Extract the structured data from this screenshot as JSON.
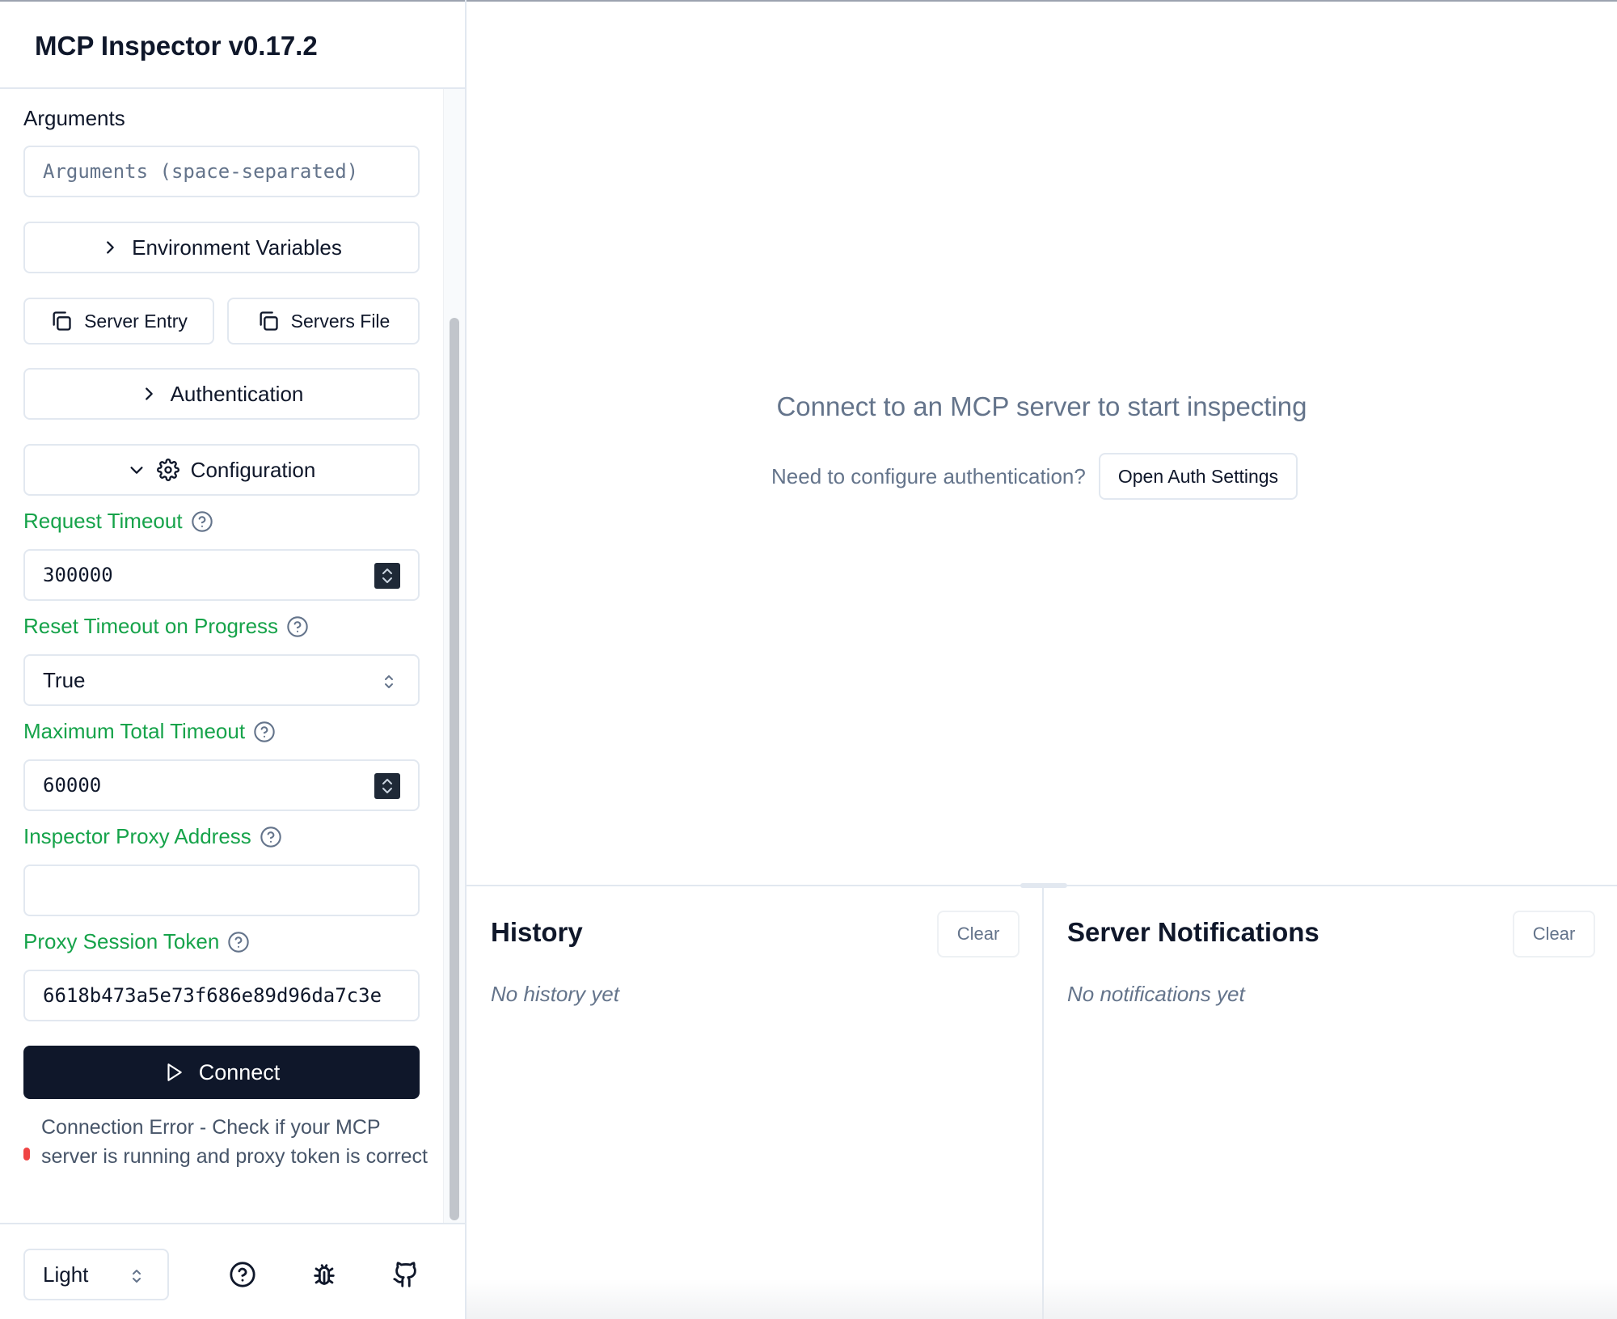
{
  "app": {
    "title": "MCP Inspector v0.17.2"
  },
  "sidebar": {
    "arguments_label": "Arguments",
    "arguments_placeholder": "Arguments (space-separated)",
    "env_vars_label": "Environment Variables",
    "server_entry_label": "Server Entry",
    "servers_file_label": "Servers File",
    "authentication_label": "Authentication",
    "configuration_label": "Configuration",
    "request_timeout": {
      "label": "Request Timeout",
      "value": "300000"
    },
    "reset_timeout": {
      "label": "Reset Timeout on Progress",
      "value": "True"
    },
    "max_total_timeout": {
      "label": "Maximum Total Timeout",
      "value": "60000"
    },
    "proxy_address": {
      "label": "Inspector Proxy Address",
      "value": ""
    },
    "proxy_token": {
      "label": "Proxy Session Token",
      "value": "6618b473a5e73f686e89d96da7c3e"
    },
    "connect_label": "Connect",
    "error_text": "Connection Error - Check if your MCP server is running and proxy token is correct",
    "theme_value": "Light"
  },
  "main": {
    "empty_title": "Connect to an MCP server to start inspecting",
    "auth_hint": "Need to configure authentication?",
    "auth_button": "Open Auth Settings",
    "history": {
      "title": "History",
      "clear": "Clear",
      "empty": "No history yet"
    },
    "notifications": {
      "title": "Server Notifications",
      "clear": "Clear",
      "empty": "No notifications yet"
    }
  },
  "colors": {
    "accent_green": "#16a34a",
    "primary_dark": "#0f172a",
    "muted_text": "#64748b",
    "border": "#e2e8f0",
    "error_red": "#ef4444"
  },
  "icons": [
    "chevron-right-icon",
    "copy-icon",
    "chevron-down-icon",
    "gear-icon",
    "help-circle-icon",
    "up-down-chevron-icon",
    "play-icon",
    "bug-icon",
    "github-icon"
  ]
}
